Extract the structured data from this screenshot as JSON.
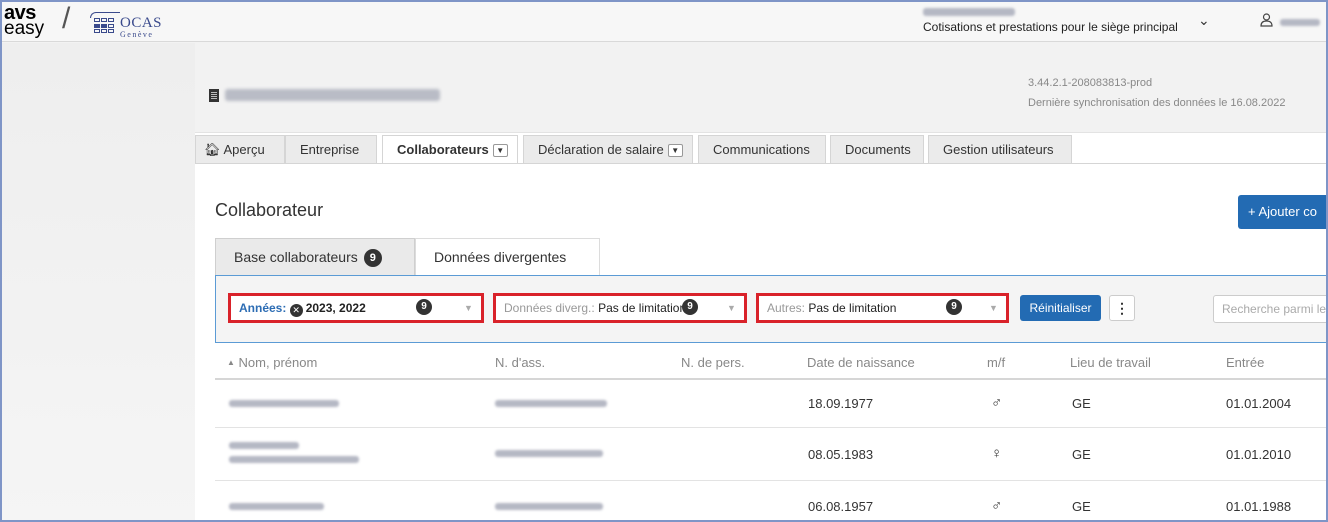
{
  "header": {
    "brand_top": "avs",
    "brand_bottom": "easy",
    "separator": "/",
    "org_logo": "OCAS",
    "org_sub": "Genève",
    "user_role": "Cotisations et prestations pour le siège principal",
    "chevron_icon": "chevron-down",
    "user_icon": "user-outline"
  },
  "company": {
    "version": "3.44.2.1-208083813-prod",
    "sync": "Dernière synchronisation des données le 16.08.2022"
  },
  "nav": {
    "tabs": [
      {
        "label": "Aperçu",
        "icon": "home"
      },
      {
        "label": "Entreprise"
      },
      {
        "label": "Collaborateurs",
        "dropdown": true,
        "active": true
      },
      {
        "label": "Déclaration de salaire",
        "dropdown": true
      },
      {
        "label": "Communications"
      },
      {
        "label": "Documents"
      },
      {
        "label": "Gestion utilisateurs"
      }
    ]
  },
  "page": {
    "title": "Collaborateur",
    "add_button": "+ Ajouter co"
  },
  "subtabs": {
    "base": "Base collaborateurs",
    "base_count": "9",
    "divergent": "Données divergentes"
  },
  "filters": {
    "years_label": "Années:",
    "years_value": "2023, 2022",
    "years_count": "9",
    "diverg_label": "Données diverg.:",
    "diverg_value": "Pas de limitation",
    "diverg_count": "9",
    "others_label": "Autres:",
    "others_value": "Pas de limitation",
    "others_count": "9",
    "reset": "Réinitialiser",
    "search_placeholder": "Recherche parmi le"
  },
  "table": {
    "columns": [
      "Nom, prénom",
      "N. d'ass.",
      "N. de pers.",
      "Date de naissance",
      "m/f",
      "Lieu de travail",
      "Entrée"
    ],
    "rows": [
      {
        "birth": "18.09.1977",
        "sex": "♂",
        "place": "GE",
        "entry": "01.01.2004"
      },
      {
        "birth": "08.05.1983",
        "sex": "♀",
        "place": "GE",
        "entry": "01.01.2010"
      },
      {
        "birth": "06.08.1957",
        "sex": "♂",
        "place": "GE",
        "entry": "01.01.1988"
      }
    ]
  },
  "colors": {
    "primary": "#236bb3",
    "highlight": "#d9222a",
    "border_frame": "#7f95c7"
  }
}
